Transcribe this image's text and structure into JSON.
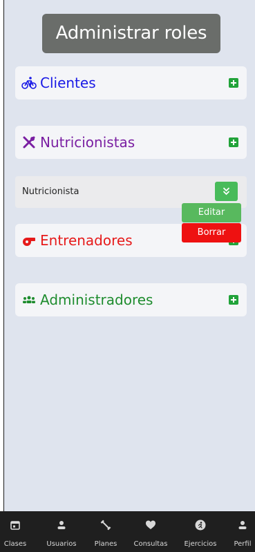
{
  "page": {
    "title": "Administrar roles"
  },
  "roles": [
    {
      "label": "Clientes",
      "color": "#1a1ae6",
      "icon": "bicycle-icon"
    },
    {
      "label": "Nutricionistas",
      "color": "#7a1fa2",
      "icon": "utensils-icon"
    },
    {
      "label": "Entrenadores",
      "color": "#e61a1a",
      "icon": "whistle-icon"
    },
    {
      "label": "Administradores",
      "color": "#1e8c2e",
      "icon": "users-icon"
    }
  ],
  "expanded_item": {
    "label": "Nutricionista"
  },
  "context_menu": {
    "edit_label": "Editar",
    "delete_label": "Borrar"
  },
  "nav": {
    "items": [
      {
        "label": "Clases",
        "icon": "calendar-icon"
      },
      {
        "label": "Usuarios",
        "icon": "user-icon"
      },
      {
        "label": "Planes",
        "icon": "dumbbell-icon"
      },
      {
        "label": "Consultas",
        "icon": "heart-icon"
      },
      {
        "label": "Ejercicios",
        "icon": "running-icon"
      },
      {
        "label": "Perfil",
        "icon": "profile-icon"
      }
    ]
  },
  "colors": {
    "background": "#dfe4ee",
    "accent_green": "#22a33a",
    "delete_red": "#ee1111",
    "navbar": "#1f1f1f"
  }
}
